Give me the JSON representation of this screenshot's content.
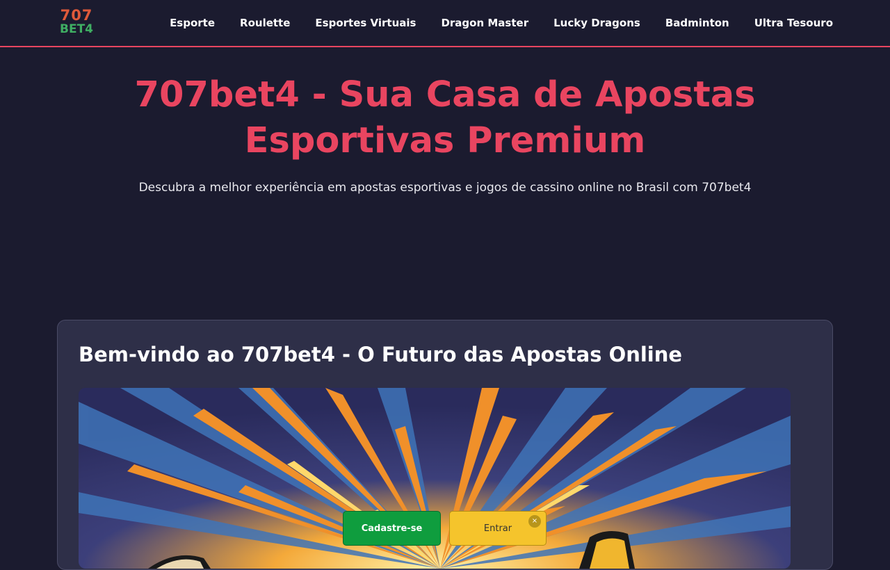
{
  "header": {
    "logo_top": "707",
    "logo_bottom": "BET4",
    "nav": [
      "Esporte",
      "Roulette",
      "Esportes Virtuais",
      "Dragon Master",
      "Lucky Dragons",
      "Badminton",
      "Ultra Tesouro"
    ]
  },
  "hero": {
    "title": "707bet4 - Sua Casa de Apostas Esportivas Premium",
    "subtitle": "Descubra a melhor experiência em apostas esportivas e jogos de cassino online no Brasil com 707bet4"
  },
  "welcome": {
    "title": "Bem-vindo ao 707bet4 - O Futuro das Apostas Online"
  },
  "cta": {
    "register": "Cadastre-se",
    "login": "Entrar",
    "close": "×"
  },
  "colors": {
    "accent": "#e94560",
    "background": "#1b1b2f",
    "card": "#2e2f48",
    "register": "#0f9d3e",
    "login": "#f5c42c"
  }
}
